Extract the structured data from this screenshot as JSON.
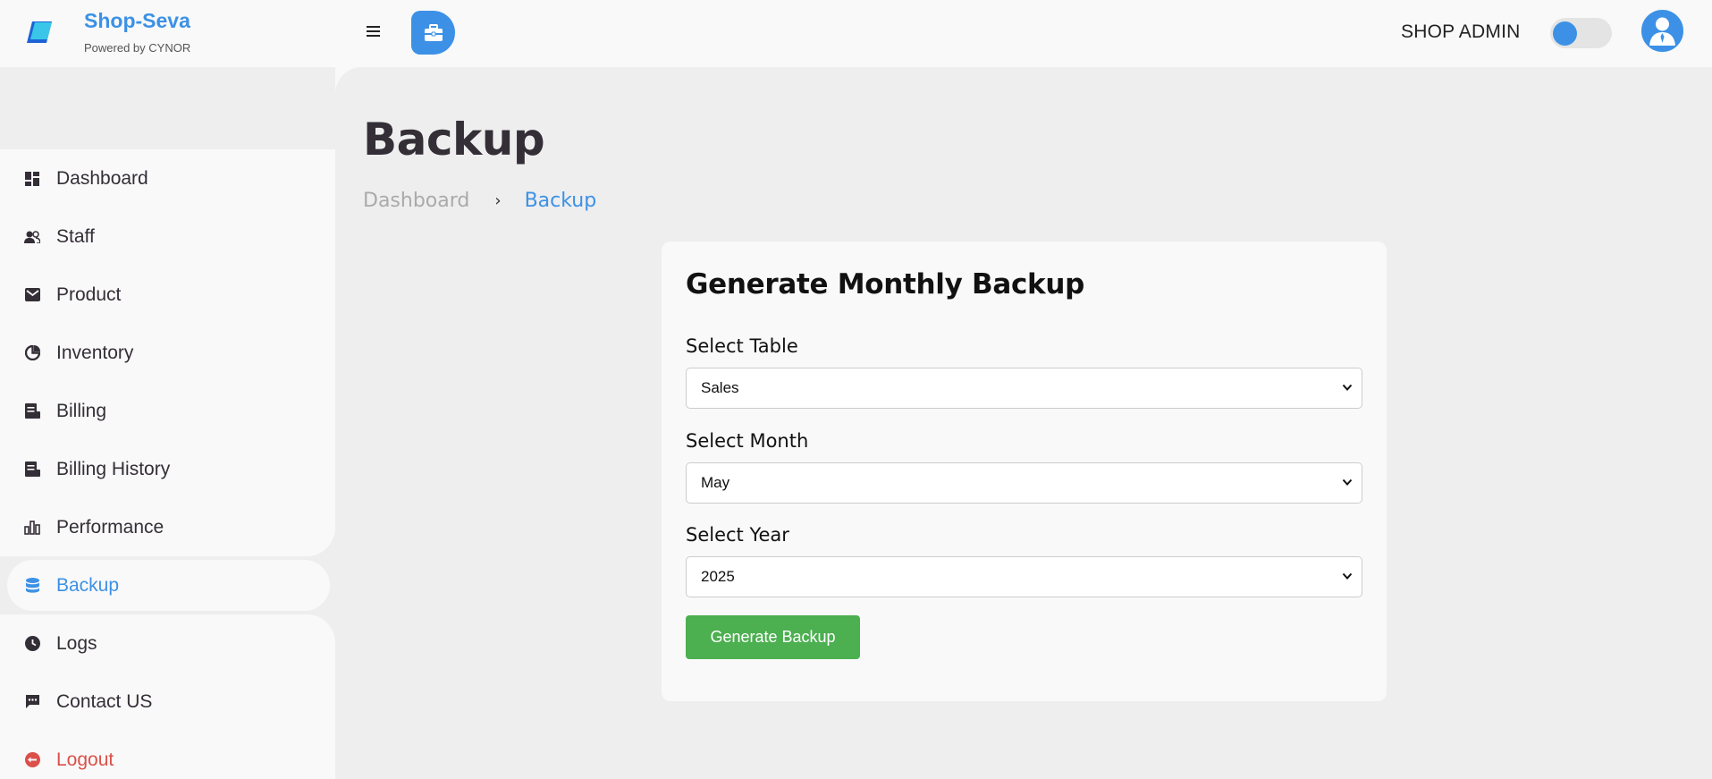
{
  "brand": {
    "name": "Shop-Seva",
    "subtitle": "Powered by CYNOR"
  },
  "topbar": {
    "role": "SHOP ADMIN",
    "menu_icon": "hamburger-icon",
    "shop_icon": "briefcase-icon",
    "avatar_icon": "user-avatar-icon",
    "theme_toggle": "on"
  },
  "colors": {
    "accent": "#3c91e6",
    "danger": "#db504a",
    "success": "#4caf50",
    "sidebar_bg": "#f9f9f9",
    "main_bg": "#eeeeee"
  },
  "sidebar": {
    "items": [
      {
        "label": "Dashboard",
        "icon": "dashboard-icon"
      },
      {
        "label": "Staff",
        "icon": "staff-icon"
      },
      {
        "label": "Product",
        "icon": "product-icon"
      },
      {
        "label": "Inventory",
        "icon": "inventory-icon"
      },
      {
        "label": "Billing",
        "icon": "billing-icon"
      },
      {
        "label": "Billing History",
        "icon": "billing-history-icon"
      },
      {
        "label": "Performance",
        "icon": "performance-icon"
      },
      {
        "label": "Backup",
        "icon": "database-icon",
        "active": true
      },
      {
        "label": "Logs",
        "icon": "clock-icon"
      },
      {
        "label": "Contact US",
        "icon": "chat-icon"
      },
      {
        "label": "Logout",
        "icon": "logout-icon"
      }
    ]
  },
  "main": {
    "title": "Backup",
    "breadcrumb": {
      "home": "Dashboard",
      "separator": "›",
      "current": "Backup"
    },
    "card": {
      "title": "Generate Monthly Backup",
      "table_label": "Select Table",
      "table_value": "Sales",
      "month_label": "Select Month",
      "month_value": "May",
      "year_label": "Select Year",
      "year_value": "2025",
      "button_label": "Generate Backup"
    }
  }
}
